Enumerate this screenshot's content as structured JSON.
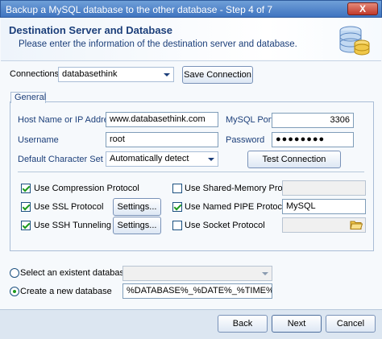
{
  "window": {
    "title": "Backup a MySQL database to the other database - Step 4 of 7",
    "close": "X"
  },
  "header": {
    "title": "Destination Server and Database",
    "subtitle": "Please enter the information of the destination server and database."
  },
  "connections": {
    "label": "Connections",
    "value": "databasethink",
    "save_label": "Save Connection"
  },
  "general_tab": "General",
  "host": {
    "label": "Host Name or IP Address",
    "value": "www.databasethink.com"
  },
  "port": {
    "label": "MySQL Port",
    "value": "3306"
  },
  "username": {
    "label": "Username",
    "value": "root"
  },
  "password": {
    "label": "Password",
    "value": "●●●●●●●●"
  },
  "charset": {
    "label": "Default Character Set",
    "value": "Automatically detect"
  },
  "test_label": "Test Connection",
  "options": {
    "compression": "Use Compression Protocol",
    "ssl": "Use SSL Protocol",
    "ssh": "Use SSH Tunneling",
    "settings": "Settings...",
    "shared_memory": "Use Shared-Memory Protocol",
    "named_pipe": "Use Named PIPE Protocol",
    "named_pipe_value": "MySQL",
    "socket": "Use Socket Protocol"
  },
  "database": {
    "existent_label": "Select an existent database",
    "new_label": "Create a new database",
    "new_value": "%DATABASE%_%DATE%_%TIME%"
  },
  "footer": {
    "back": "Back",
    "next": "Next",
    "cancel": "Cancel"
  },
  "colors": {
    "accent": "#1c3f7a",
    "titlebar": "#3f74c0",
    "check": "#1d9a1d"
  }
}
